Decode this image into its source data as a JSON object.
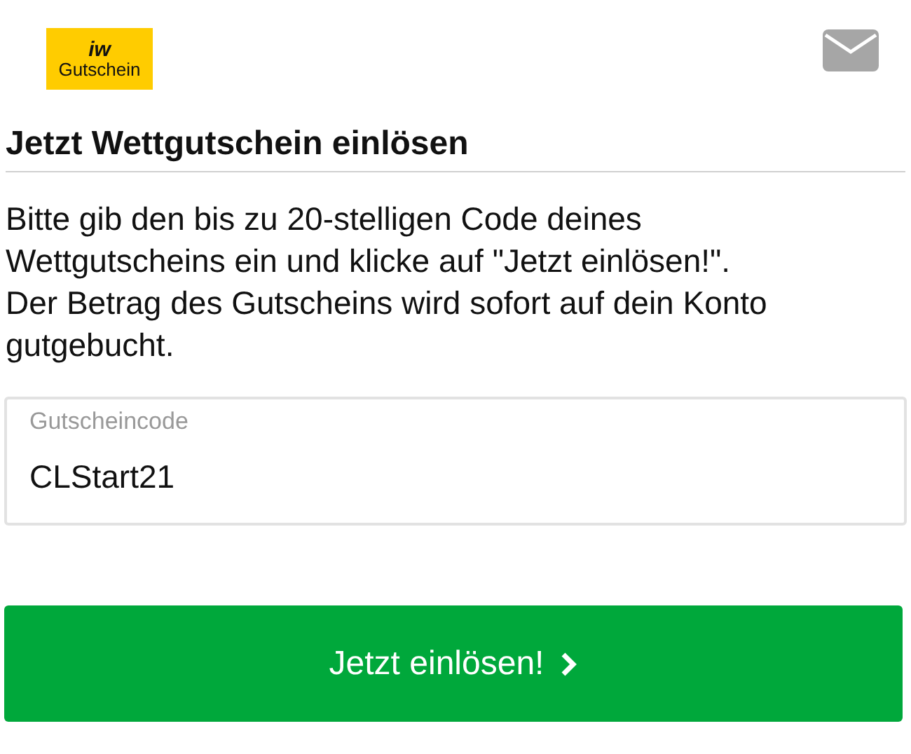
{
  "logo": {
    "top": "iw",
    "bottom": "Gutschein"
  },
  "title": "Jetzt Wettgutschein einlösen",
  "intro": "Bitte gib den bis zu 20-stelligen Code deines Wettgutscheins ein und klicke auf \"Jetzt einlösen!\". Der Betrag des Gutscheins wird sofort auf dein Konto gutgebucht.",
  "code_field": {
    "label": "Gutscheincode",
    "value": "CLStart21"
  },
  "submit_button": "Jetzt einlösen!"
}
